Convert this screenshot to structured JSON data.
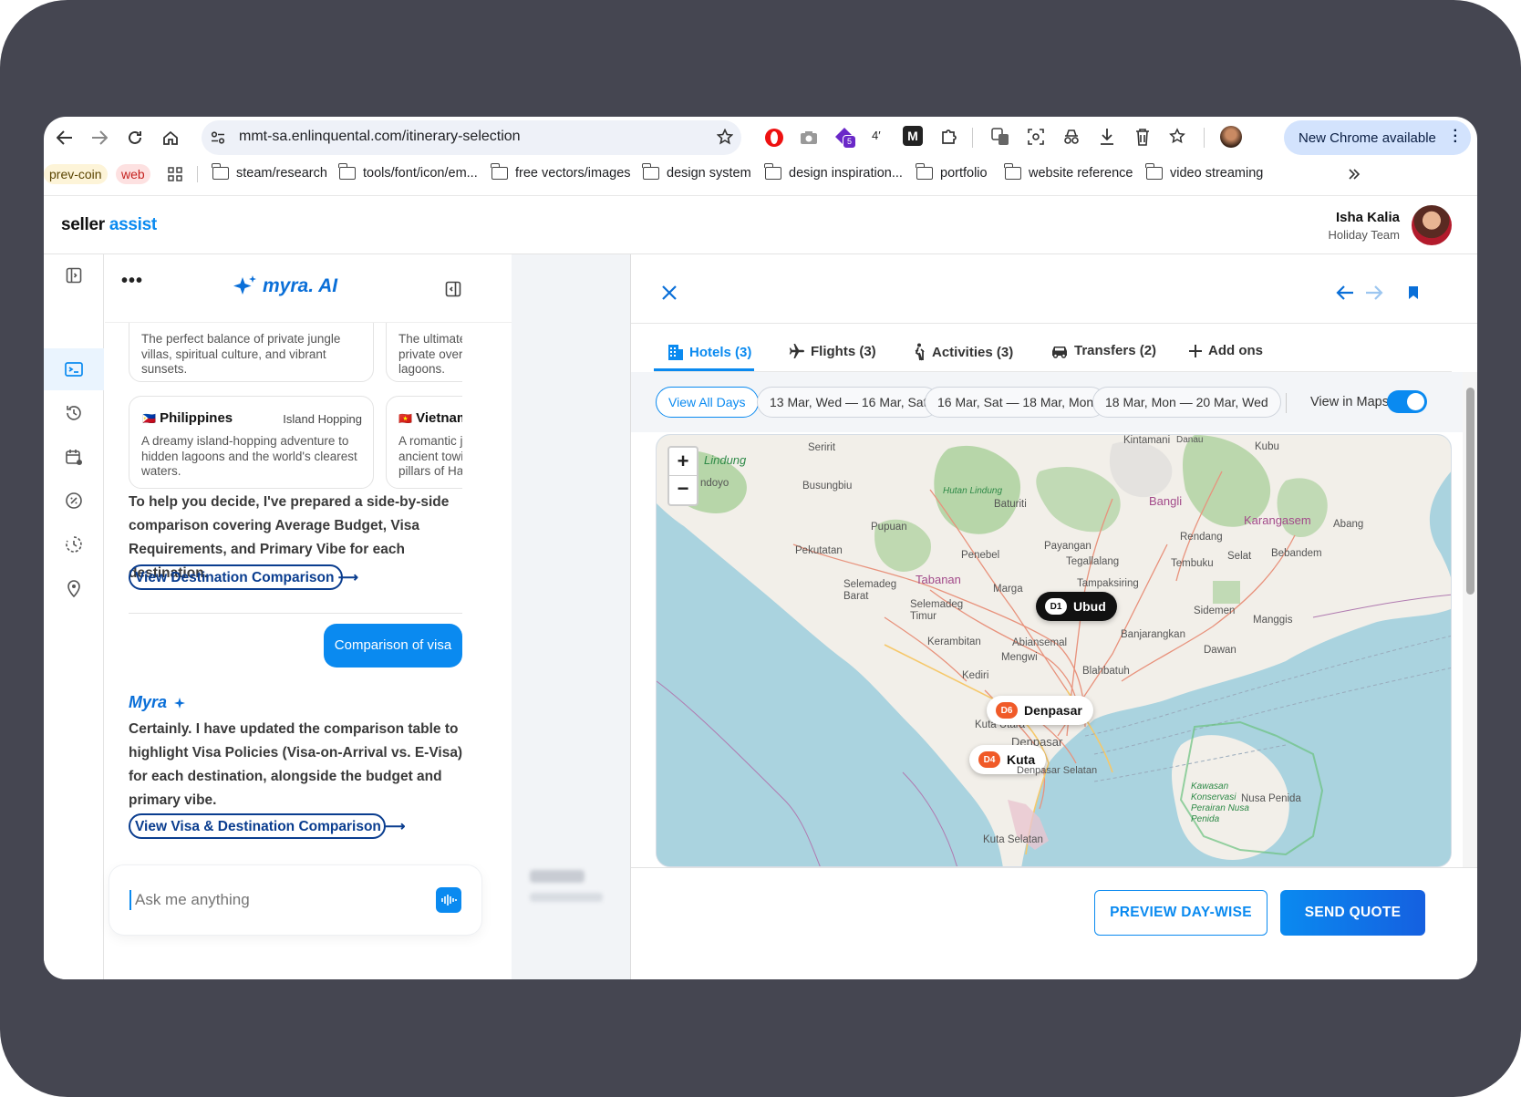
{
  "browser": {
    "url": "mmt-sa.enlinquental.com/itinerary-selection",
    "new_chrome": "New Chrome available",
    "ext_badge": "5",
    "ext_text": "4′",
    "ext_m": "M",
    "bookmarks": [
      {
        "label": "prev-coin",
        "type": "chip"
      },
      {
        "label": "web",
        "type": "chip"
      },
      {
        "label": "steam/research"
      },
      {
        "label": "tools/font/icon/em..."
      },
      {
        "label": "free vectors/images"
      },
      {
        "label": "design system"
      },
      {
        "label": "design inspiration..."
      },
      {
        "label": "portfolio"
      },
      {
        "label": "website reference"
      },
      {
        "label": "video streaming"
      }
    ]
  },
  "app": {
    "brand_a": "seller",
    "brand_b": "assist",
    "user_name": "Isha Kalia",
    "user_team": "Holiday Team"
  },
  "chat": {
    "title": "myra. AI",
    "cards_top": [
      {
        "desc": "The perfect balance of private jungle villas, spiritual culture, and vibrant sunsets."
      },
      {
        "desc": "The ultimate private over lagoons."
      }
    ],
    "cards": [
      {
        "flag": "🇵🇭",
        "country": "Philippines",
        "tag": "Island Hopping",
        "desc": "A dreamy island-hopping adventure to hidden lagoons and the world's clearest waters."
      },
      {
        "flag": "🇻🇳",
        "country": "Vietnam",
        "tag": "",
        "desc": "A romantic j ancient towi pillars of Ha"
      }
    ],
    "para1": "To help you decide, I've prepared a side-by-side comparison covering Average Budget, Visa Requirements, and Primary Vibe for each destination.",
    "link1": "View Destination Comparison ⟶",
    "user_msg": "Comparison of visa",
    "bot_name": "Myra",
    "para2": "Certainly. I have updated the comparison table to highlight Visa Policies (Visa-on-Arrival vs. E-Visa) for each destination, alongside the budget and primary vibe.",
    "link2": "View Visa & Destination Comparison ⟶",
    "input_placeholder": "Ask me anything"
  },
  "panel": {
    "tabs": [
      {
        "label": "Hotels (3)",
        "icon": "building-icon",
        "active": true
      },
      {
        "label": "Flights (3)",
        "icon": "plane-icon"
      },
      {
        "label": "Activities (3)",
        "icon": "hiker-icon"
      },
      {
        "label": "Transfers (2)",
        "icon": "car-icon"
      },
      {
        "label": "Add ons",
        "icon": "plus-icon"
      }
    ],
    "days": [
      "View All Days",
      "13 Mar, Wed — 16 Mar, Sat",
      "16 Mar, Sat — 18 Mar, Mon",
      "18 Mar, Mon — 20 Mar, Wed"
    ],
    "view_in_maps": "View in Maps",
    "maps_on": true,
    "zoom_in": "+",
    "zoom_out": "−",
    "pins": [
      {
        "day": "D1",
        "name": "Ubud"
      },
      {
        "day": "D6",
        "name": "Denpasar"
      },
      {
        "day": "D4",
        "name": "Kuta"
      }
    ],
    "map_labels": [
      "Lindung",
      "ndoyo",
      "Seririt",
      "Busungbiu",
      "Hutan Lindung",
      "Baturiti",
      "Bangli",
      "Kintamani",
      "Kubu",
      "Karangasem",
      "Abang",
      "Pupuan",
      "Pekutatan",
      "Penebel",
      "Payangan",
      "Tegallalang",
      "Tembuku",
      "Rendang",
      "Selat",
      "Bebandem",
      "Tabanan",
      "Selemadeg Barat",
      "Selemadeg Timur",
      "Marga",
      "Tampaksiring",
      "Sidemen",
      "Manggis",
      "Kerambitan",
      "Abiansemal",
      "Mengwi",
      "Banjarangkan",
      "Dawan",
      "Blahbatuh",
      "Kediri",
      "Kuta Utara",
      "Denpasar",
      "Denpasar Selatan",
      "Kuta Selatan",
      "Kawasan Konservasi Perairan Nusa Penida",
      "Nusa Penida",
      "Danau"
    ],
    "preview_btn": "PREVIEW DAY-WISE",
    "send_btn": "SEND QUOTE",
    "accent": "#0a8af0"
  }
}
